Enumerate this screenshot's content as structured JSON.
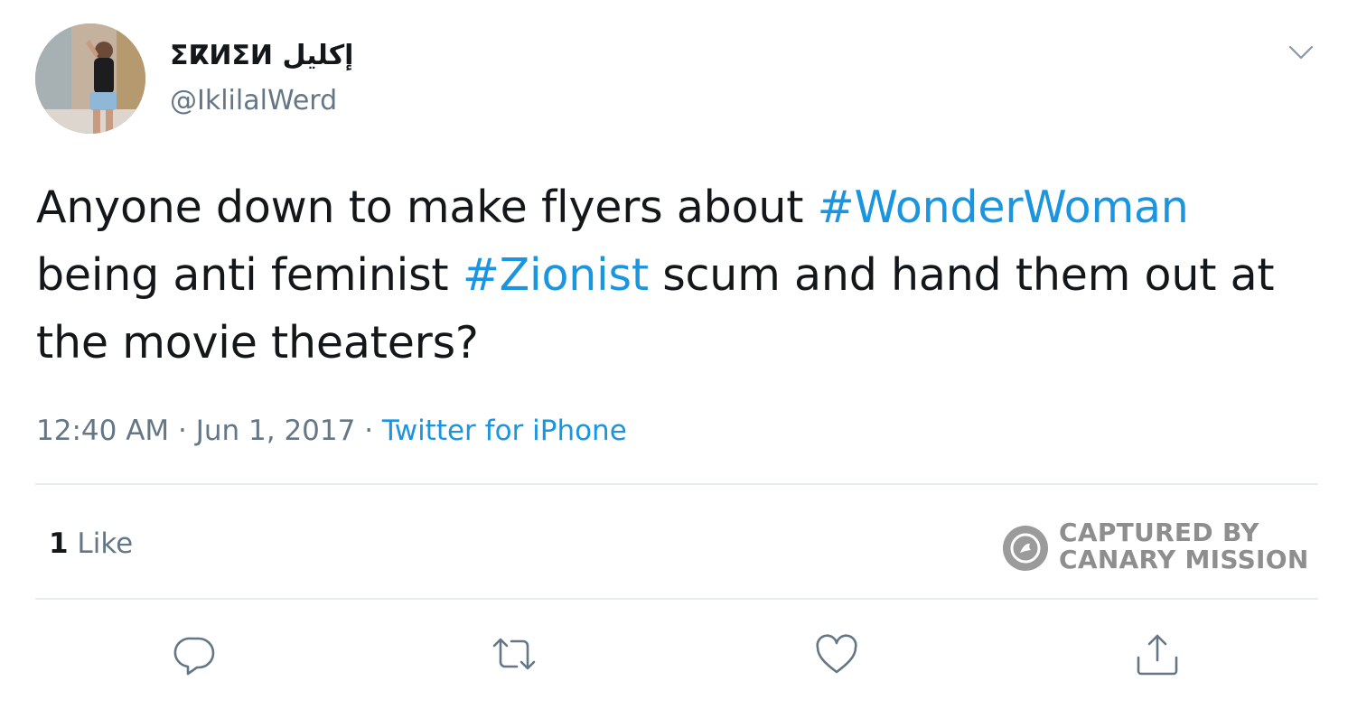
{
  "user": {
    "display_name": "ⵉⴽⵍⵉⵍ إكليل",
    "handle": "@IklilalWerd",
    "avatar": "profile-photo"
  },
  "tweet": {
    "text_parts": [
      {
        "type": "text",
        "value": "Anyone down to make flyers about "
      },
      {
        "type": "hashtag",
        "value": "#WonderWoman"
      },
      {
        "type": "text",
        "value": " being anti feminist "
      },
      {
        "type": "hashtag",
        "value": "#Zionist"
      },
      {
        "type": "text",
        "value": " scum and hand them out at the movie theaters?"
      }
    ],
    "time": "12:40 AM",
    "separator": " · ",
    "date": "Jun 1, 2017",
    "source": "Twitter for iPhone"
  },
  "stats": {
    "like_count": "1",
    "like_label": " Like"
  },
  "watermark": {
    "line1": "CAPTURED BY",
    "line2": "CANARY MISSION"
  },
  "icons": {
    "caret": "chevron-down-icon",
    "reply": "reply-icon",
    "retweet": "retweet-icon",
    "like": "heart-icon",
    "share": "share-icon"
  },
  "colors": {
    "text": "#14171a",
    "secondary": "#657786",
    "link": "#1b95e0",
    "divider": "#e6ecf0",
    "watermark": "#8e8e8e"
  }
}
